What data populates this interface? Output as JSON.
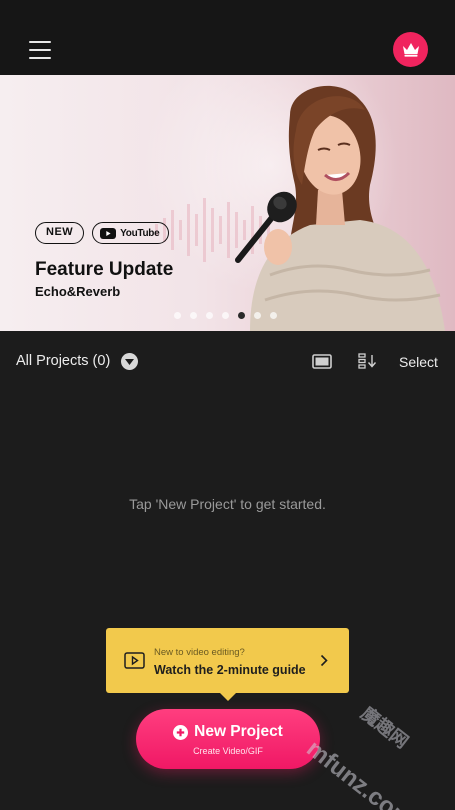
{
  "colors": {
    "accent": "#f0245e",
    "guide_background": "#f2c94c",
    "background": "#1c1c1c"
  },
  "topbar": {
    "menu_icon": "hamburger-menu-icon",
    "premium_icon": "crown-icon"
  },
  "banner": {
    "badge_new": "NEW",
    "badge_youtube": "YouTube",
    "title": "Feature Update",
    "subtitle": "Echo&Reverb",
    "page_count": 7,
    "active_page": 5
  },
  "projects": {
    "title": "All Projects (0)",
    "view_icon": "grid-view-icon",
    "sort_icon": "sort-icon",
    "select_label": "Select",
    "empty_message": "Tap 'New Project' to get started."
  },
  "guide": {
    "small_text": "New to video editing?",
    "main_text": "Watch the 2-minute guide",
    "icon": "play-video-icon"
  },
  "new_project": {
    "label": "New Project",
    "sublabel": "Create Video/GIF",
    "icon": "plus-circle-icon"
  },
  "watermark": {
    "text": "mfunz.com",
    "text_cn": "魔趣网"
  }
}
